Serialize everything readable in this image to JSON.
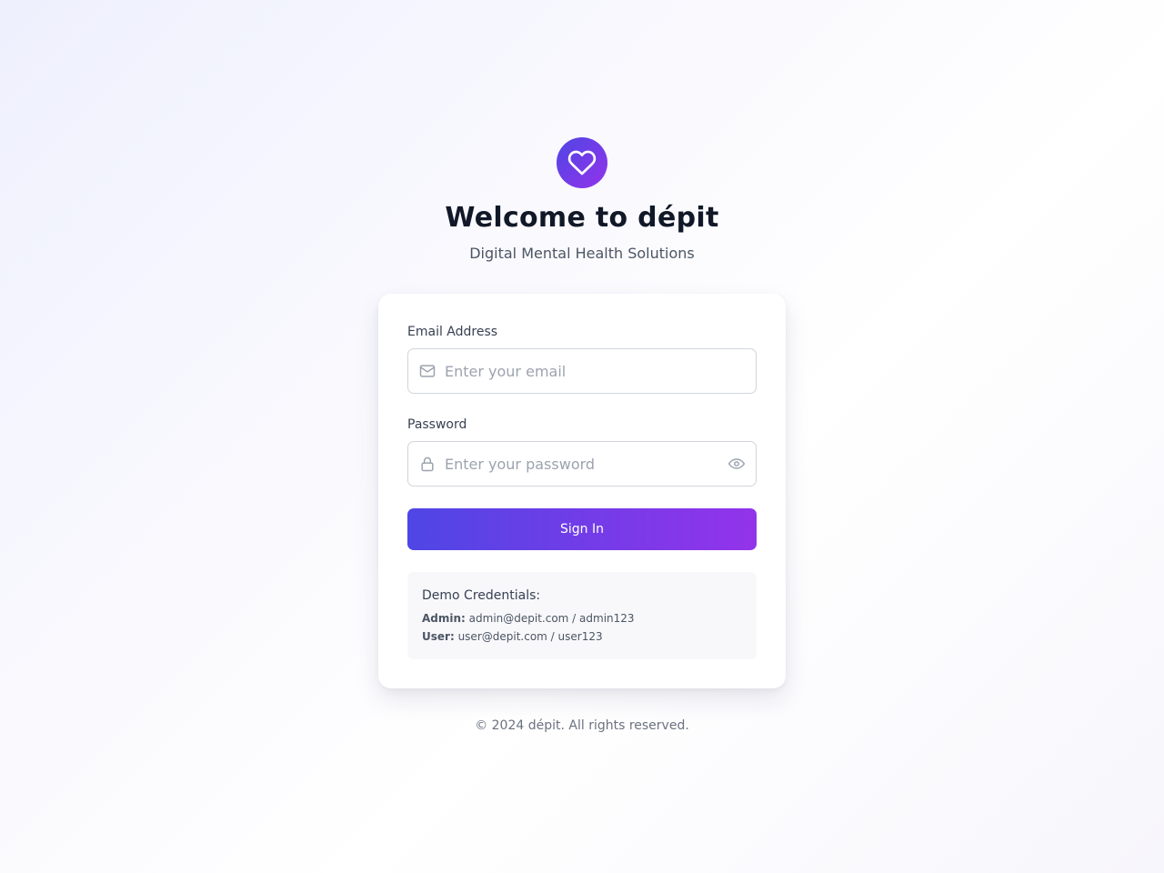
{
  "header": {
    "title": "Welcome to dépit",
    "subtitle": "Digital Mental Health Solutions",
    "logo_icon": "heart-icon"
  },
  "form": {
    "email_label": "Email Address",
    "email_placeholder": "Enter your email",
    "email_value": "",
    "email_icon": "mail-icon",
    "password_label": "Password",
    "password_placeholder": "Enter your password",
    "password_value": "",
    "password_icon": "lock-icon",
    "toggle_icon": "eye-icon",
    "submit_label": "Sign In"
  },
  "demo": {
    "title": "Demo Credentials:",
    "admin_label": "Admin:",
    "admin_value": "admin@depit.com / admin123",
    "user_label": "User:",
    "user_value": "user@depit.com / user123"
  },
  "footer": {
    "text": "© 2024 dépit. All rights reserved."
  },
  "colors": {
    "accent_start": "#4f46e5",
    "accent_end": "#9333ea",
    "heading": "#111827",
    "muted": "#4b5563"
  }
}
